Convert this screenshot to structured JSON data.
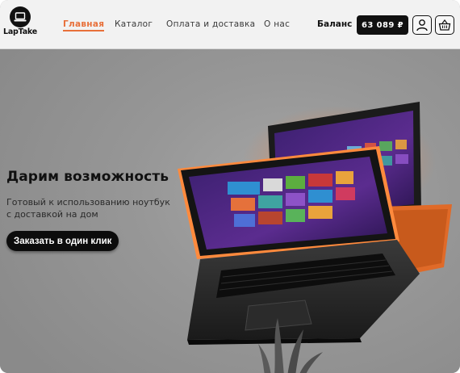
{
  "brand": {
    "name": "LapTake",
    "icon": "laptop-logo-icon"
  },
  "nav": {
    "items": [
      {
        "label": "Главная",
        "active": true
      },
      {
        "label": "Каталог",
        "active": false
      },
      {
        "label": "Оплата и доставка",
        "active": false
      },
      {
        "label": "О нас",
        "active": false
      }
    ]
  },
  "account": {
    "balance_label": "Баланс",
    "balance_value": "63 089 ₽",
    "profile_icon": "user-icon",
    "cart_icon": "basket-icon"
  },
  "hero": {
    "title": "Дарим возможность",
    "subtitle": "Готовый к использованию ноутбук с доставкой на дом",
    "cta_label": "Заказать в один клик",
    "image": "convertible-laptop-image"
  },
  "colors": {
    "accent": "#e8703a",
    "dark": "#111111",
    "header_bg": "#f2f2f2"
  }
}
